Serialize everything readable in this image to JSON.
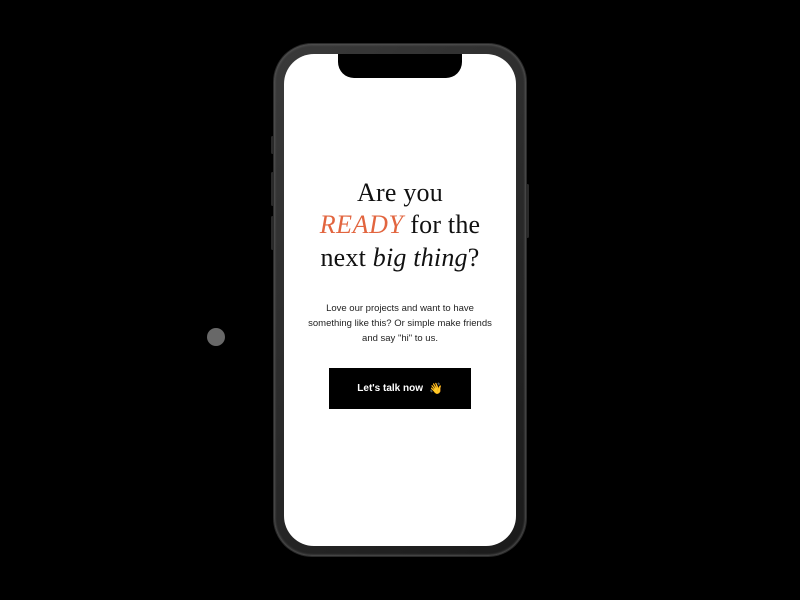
{
  "headline": {
    "line1": "Are you",
    "accent": "READY",
    "mid": " for the",
    "line3_pre": "next ",
    "accent2": "big thing",
    "suffix": "?"
  },
  "subtext": "Love our projects and want to have something like this? Or simple make friends and say \"hi\" to us.",
  "cta": {
    "label": "Let's talk now",
    "icon": "👋"
  }
}
